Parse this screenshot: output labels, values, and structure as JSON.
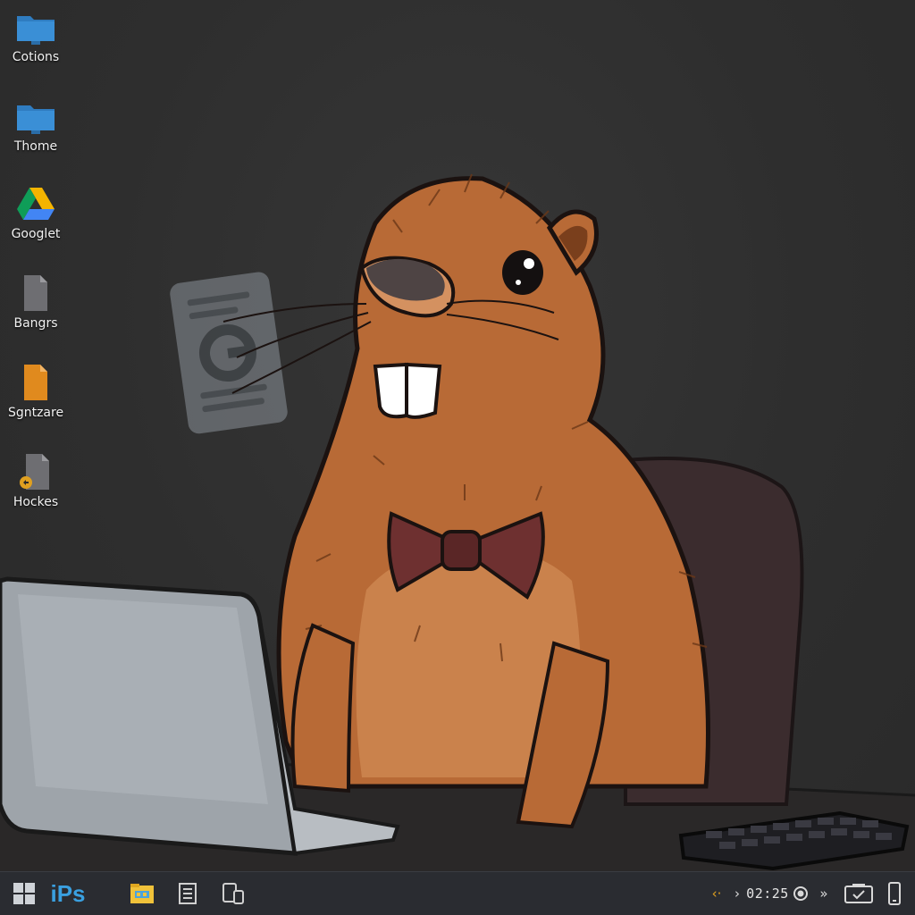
{
  "desktop": {
    "icons": [
      {
        "label": "Cotions",
        "icon": "folder-icon"
      },
      {
        "label": "Thome",
        "icon": "folder-icon"
      },
      {
        "label": "Googlet",
        "icon": "google-drive-icon"
      },
      {
        "label": "Bangrs",
        "icon": "document-icon"
      },
      {
        "label": "Sgntzare",
        "icon": "orange-document-icon"
      },
      {
        "label": "Hockes",
        "icon": "shortcut-document-icon"
      }
    ]
  },
  "taskbar": {
    "start_icon": "windows-start-icon",
    "pinned_app_label": "iPs",
    "pinned_icons": [
      "file-explorer-icon",
      "notepad-icon",
      "devices-icon"
    ],
    "tray": {
      "arrow_left": "‹·",
      "arrow_right": "›",
      "time": "02:25",
      "forward": "»",
      "icons": [
        "record-icon",
        "tablet-check-icon",
        "phone-icon"
      ]
    }
  },
  "colors": {
    "background": "#2f2f2f",
    "taskbar": "#2a2c31",
    "folder_blue": "#3a8fd6",
    "beaver_fur": "#b86a36",
    "bow_tie": "#6e3030",
    "laptop": "#9ea4aa"
  }
}
